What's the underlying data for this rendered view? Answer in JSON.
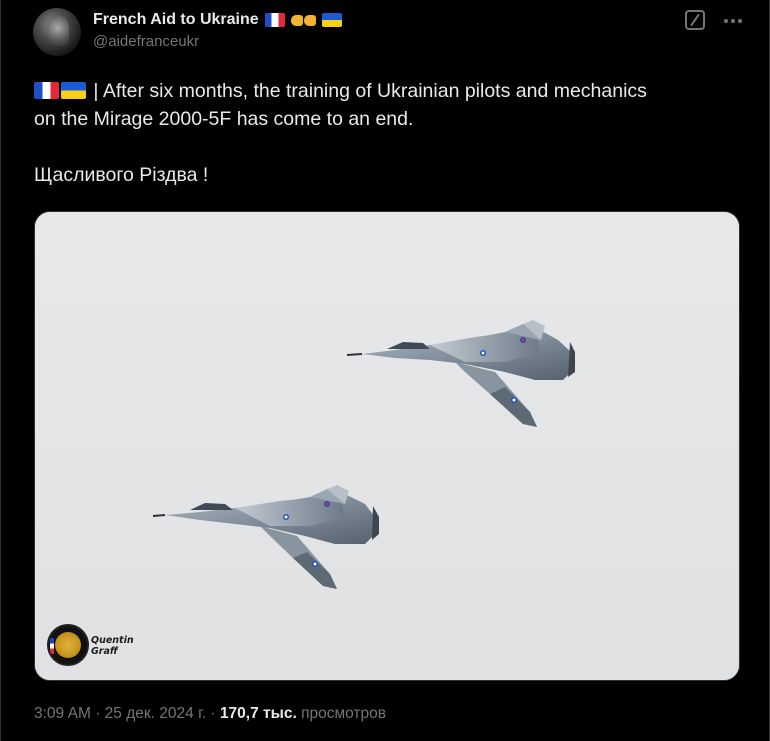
{
  "author": {
    "display_name": "French Aid to Ukraine",
    "handle": "@aidefranceukr",
    "avatar_icon": "cat-avatar"
  },
  "tweet": {
    "text_line_1": "| After six months, the training of Ukrainian pilots and mechanics",
    "text_line_2": "on the Mirage 2000-5F has come to an end.",
    "text_line_3": "Щасливого Різдва !"
  },
  "media": {
    "watermark_line_1": "Quentin",
    "watermark_line_2": "Graff"
  },
  "meta": {
    "time": "3:09 AM",
    "separator": "·",
    "date": "25 дек. 2024 г.",
    "views_count": "170,7 тыс.",
    "views_label": "просмотров"
  },
  "colors": {
    "background": "#000000",
    "text_primary": "#e7e9ea",
    "text_secondary": "#71767b",
    "sky": "#e3e5e7"
  },
  "icons": [
    "france-flag-icon",
    "fist-bump-icon",
    "ukraine-flag-icon",
    "grok-icon",
    "more-icon"
  ]
}
